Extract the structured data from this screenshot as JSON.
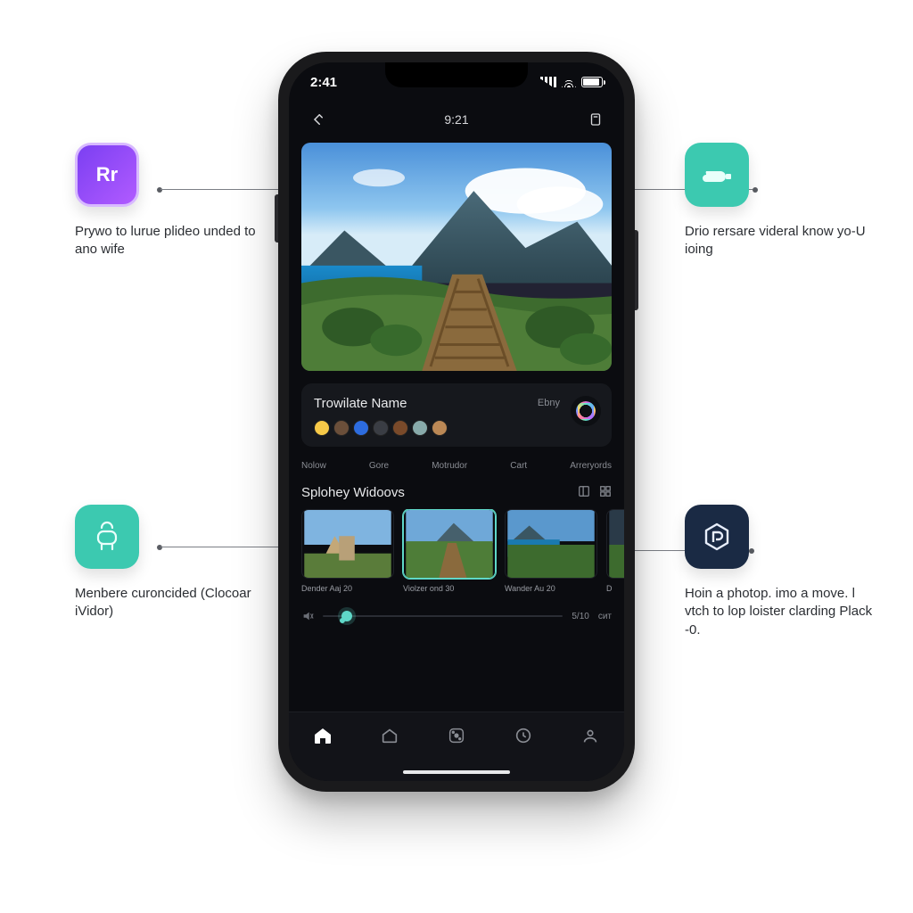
{
  "status": {
    "time": "2:41"
  },
  "header": {
    "title": "9:21"
  },
  "hero_alt": "Coastal boardwalk with mountains and blue sea",
  "info": {
    "title": "Trowilate Name",
    "badge": "Ebny"
  },
  "tabs": [
    "Nolow",
    "Gore",
    "Motrudor",
    "Cart",
    "Arreryords"
  ],
  "section": {
    "title": "Splohey Widoovs"
  },
  "thumbs": [
    {
      "caption": "Dender Aaj 20"
    },
    {
      "caption": "Violzer ond 30"
    },
    {
      "caption": "Wander Au 20"
    },
    {
      "caption": "D"
    }
  ],
  "slider": {
    "value_label": "5/10",
    "end_label": "cит"
  },
  "callouts": {
    "top_left": {
      "icon_label": "Rr",
      "text": "Prywo to lurue plideo unded to ano wife"
    },
    "top_right": {
      "text": "Drio rersare viderаl know yo-U ioing"
    },
    "bottom_left": {
      "text": "Menbere curoncided (Clocoar iVidor)"
    },
    "bottom_right": {
      "text": "Hoin a photop. imo a move. l vtch to lop loister clarding Plаck -0."
    }
  }
}
